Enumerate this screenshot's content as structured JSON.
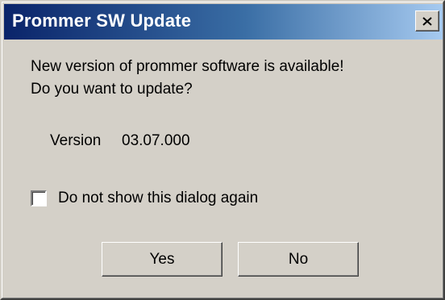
{
  "window": {
    "title": "Prommer SW Update",
    "close_icon": "close-icon"
  },
  "message": {
    "line1": "New version of prommer software is available!",
    "line2": "Do you want to update?"
  },
  "version": {
    "label": "Version",
    "value": "03.07.000"
  },
  "checkbox": {
    "label": "Do not show this dialog again",
    "checked": false
  },
  "buttons": {
    "yes": "Yes",
    "no": "No"
  },
  "colors": {
    "titlebar_start": "#0a246a",
    "titlebar_end": "#a6caf0",
    "face": "#d4d0c8"
  }
}
